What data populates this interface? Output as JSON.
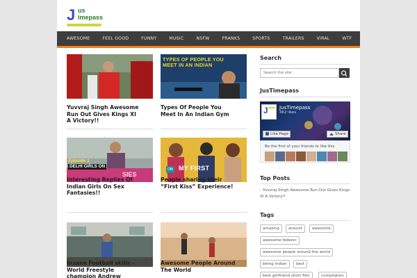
{
  "brand": {
    "logo_letter": "J",
    "logo_line1": "us",
    "logo_line2": "imepass",
    "colors": {
      "nav_bg": "#3d3d3d",
      "accent": "#f07b13",
      "logo_blue": "#3a4fb0",
      "logo_green": "#2a7a2a"
    }
  },
  "nav": {
    "items": [
      "AWESOME",
      "FEEL GOOD",
      "FUNNY",
      "MUSIC",
      "NSFW",
      "PRANKS",
      "SPORTS",
      "TRAILERS",
      "VIRAL",
      "WTF"
    ]
  },
  "posts": [
    {
      "title": "Yuvvraj Singh Awesome Run Out Gives Kings XI A Victory!!"
    },
    {
      "title": "Types Of People You Meet In An Indian Gym",
      "thumb_text": "TYPES OF PEOPLE YOU MEET IN AN INDIAN"
    },
    {
      "title": "Interesting Replies Of Indian Girls On Sex Fantasies!!",
      "thumb_badge": "Episode 1",
      "thumb_text": "DELHI GIRLS ON",
      "thumb_text2": "SIES"
    },
    {
      "title": "People sharing their “First Kiss” Experience!",
      "thumb_badge": "Ofb",
      "thumb_text": "MY FIRST"
    },
    {
      "title": "Insane Football skills – World Freestyle champion Andrew"
    },
    {
      "title": "Awesome People Around The World"
    }
  ],
  "sidebar": {
    "search": {
      "heading": "Search",
      "placeholder": "Search the site",
      "icon": "search-icon"
    },
    "facebook": {
      "heading": "JusTimepass",
      "page_name": "JusTimepass",
      "likes": "462 likes",
      "like_label": "Like Page",
      "share_label": "Share",
      "friends_text": "Be the first of your friends to like this"
    },
    "top_posts": {
      "heading": "Top Posts",
      "items": [
        "Yuvvraj Singh Awesome Run Out Gives Kings XI A Victory!!"
      ]
    },
    "tags": {
      "heading": "Tags",
      "items": [
        "amazing",
        "around",
        "awesome",
        "awesome federer",
        "awesome people around the world",
        "being indian",
        "best",
        "best girlfriend short film",
        "compilation"
      ]
    }
  }
}
